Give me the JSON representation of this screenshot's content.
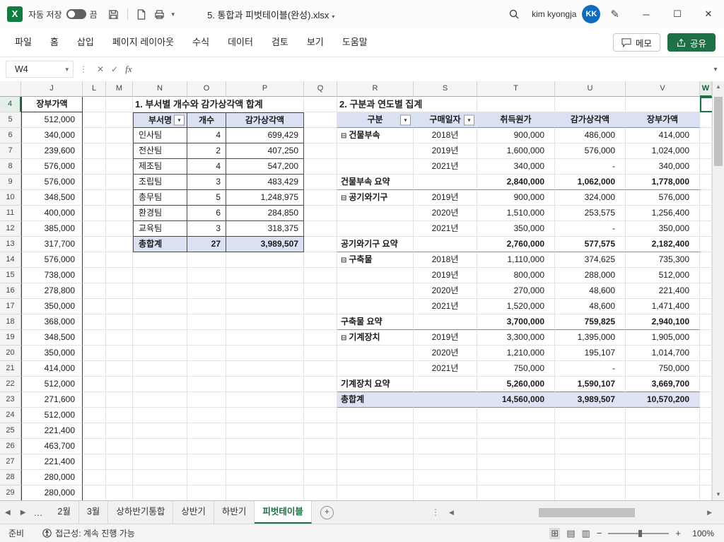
{
  "title_bar": {
    "autosave_label": "자동 저장",
    "autosave_state": "끔",
    "doc_title": "5. 통합과 피벗테이블(완성).xlsx",
    "user_name": "kim kyongja",
    "user_initials": "KK"
  },
  "ribbon": {
    "tabs": [
      "파일",
      "홈",
      "삽입",
      "페이지 레이아웃",
      "수식",
      "데이터",
      "검토",
      "보기",
      "도움말"
    ],
    "comments_label": "메모",
    "share_label": "공유"
  },
  "formula_bar": {
    "name_box": "W4",
    "cancel": "✕",
    "enter": "✓",
    "fx_label": "fx",
    "formula_value": ""
  },
  "sheet": {
    "columns": [
      "J",
      "L",
      "M",
      "N",
      "O",
      "P",
      "Q",
      "R",
      "S",
      "T",
      "U",
      "V",
      "W"
    ],
    "first_row": 4,
    "last_row": 29,
    "active_cell": "W4",
    "book_value": {
      "header": "장부가액",
      "values": [
        "512,000",
        "340,000",
        "239,600",
        "576,000",
        "576,000",
        "348,500",
        "400,000",
        "385,000",
        "317,700",
        "576,000",
        "738,000",
        "278,800",
        "350,000",
        "368,000",
        "348,500",
        "350,000",
        "414,000",
        "512,000",
        "271,600",
        "512,000",
        "221,400",
        "463,700",
        "221,400",
        "280,000",
        "280,000"
      ]
    },
    "section1": {
      "title": "1. 부서별 개수와 감가상각액 합계",
      "headers": [
        "부서명",
        "개수",
        "감가상각액"
      ],
      "rows": [
        [
          "인사팀",
          "4",
          "699,429"
        ],
        [
          "전산팀",
          "2",
          "407,250"
        ],
        [
          "제조팀",
          "4",
          "547,200"
        ],
        [
          "조립팀",
          "3",
          "483,429"
        ],
        [
          "총무팀",
          "5",
          "1,248,975"
        ],
        [
          "환경팀",
          "6",
          "284,850"
        ],
        [
          "교육팀",
          "3",
          "318,375"
        ]
      ],
      "total": [
        "총합계",
        "27",
        "3,989,507"
      ]
    },
    "section2": {
      "title": "2. 구분과 연도별 집계",
      "headers": [
        "구분",
        "구매일자",
        "취득원가",
        "감가상각액",
        "장부가액"
      ],
      "collapse_glyph": "⊟",
      "rows": [
        {
          "type": "group",
          "cells": [
            "건물부속",
            "2018년",
            "900,000",
            "486,000",
            "414,000"
          ]
        },
        {
          "type": "data",
          "cells": [
            "",
            "2019년",
            "1,600,000",
            "576,000",
            "1,024,000"
          ]
        },
        {
          "type": "data",
          "cells": [
            "",
            "2021년",
            "340,000",
            "-",
            "340,000"
          ]
        },
        {
          "type": "summary",
          "cells": [
            "건물부속 요약",
            "",
            "2,840,000",
            "1,062,000",
            "1,778,000"
          ]
        },
        {
          "type": "group",
          "cells": [
            "공기와기구",
            "2019년",
            "900,000",
            "324,000",
            "576,000"
          ]
        },
        {
          "type": "data",
          "cells": [
            "",
            "2020년",
            "1,510,000",
            "253,575",
            "1,256,400"
          ]
        },
        {
          "type": "data",
          "cells": [
            "",
            "2021년",
            "350,000",
            "-",
            "350,000"
          ]
        },
        {
          "type": "summary",
          "cells": [
            "공기와기구 요약",
            "",
            "2,760,000",
            "577,575",
            "2,182,400"
          ]
        },
        {
          "type": "group",
          "cells": [
            "구축물",
            "2018년",
            "1,110,000",
            "374,625",
            "735,300"
          ]
        },
        {
          "type": "data",
          "cells": [
            "",
            "2019년",
            "800,000",
            "288,000",
            "512,000"
          ]
        },
        {
          "type": "data",
          "cells": [
            "",
            "2020년",
            "270,000",
            "48,600",
            "221,400"
          ]
        },
        {
          "type": "data",
          "cells": [
            "",
            "2021년",
            "1,520,000",
            "48,600",
            "1,471,400"
          ]
        },
        {
          "type": "summary",
          "cells": [
            "구축물 요약",
            "",
            "3,700,000",
            "759,825",
            "2,940,100"
          ]
        },
        {
          "type": "group",
          "cells": [
            "기계장치",
            "2019년",
            "3,300,000",
            "1,395,000",
            "1,905,000"
          ]
        },
        {
          "type": "data",
          "cells": [
            "",
            "2020년",
            "1,210,000",
            "195,107",
            "1,014,700"
          ]
        },
        {
          "type": "data",
          "cells": [
            "",
            "2021년",
            "750,000",
            "-",
            "750,000"
          ]
        },
        {
          "type": "summary",
          "cells": [
            "기계장치 요약",
            "",
            "5,260,000",
            "1,590,107",
            "3,669,700"
          ]
        },
        {
          "type": "total",
          "cells": [
            "총합계",
            "",
            "14,560,000",
            "3,989,507",
            "10,570,200"
          ]
        }
      ]
    }
  },
  "sheet_tabs": {
    "overflow_indicator": "…",
    "tabs": [
      "2월",
      "3월",
      "상하반기통합",
      "상반기",
      "하반기",
      "피벗테이블"
    ],
    "active_tab": "피벗테이블"
  },
  "status_bar": {
    "mode": "준비",
    "accessibility": "접근성: 계속 진행 가능",
    "zoom": "100%"
  },
  "accent_colors": {
    "excel_green": "#1E7145",
    "pivot_header_fill": "#D9E1F2",
    "pivot_total_fill": "#DDE3F3",
    "avatar_blue": "#0F6CBD"
  }
}
